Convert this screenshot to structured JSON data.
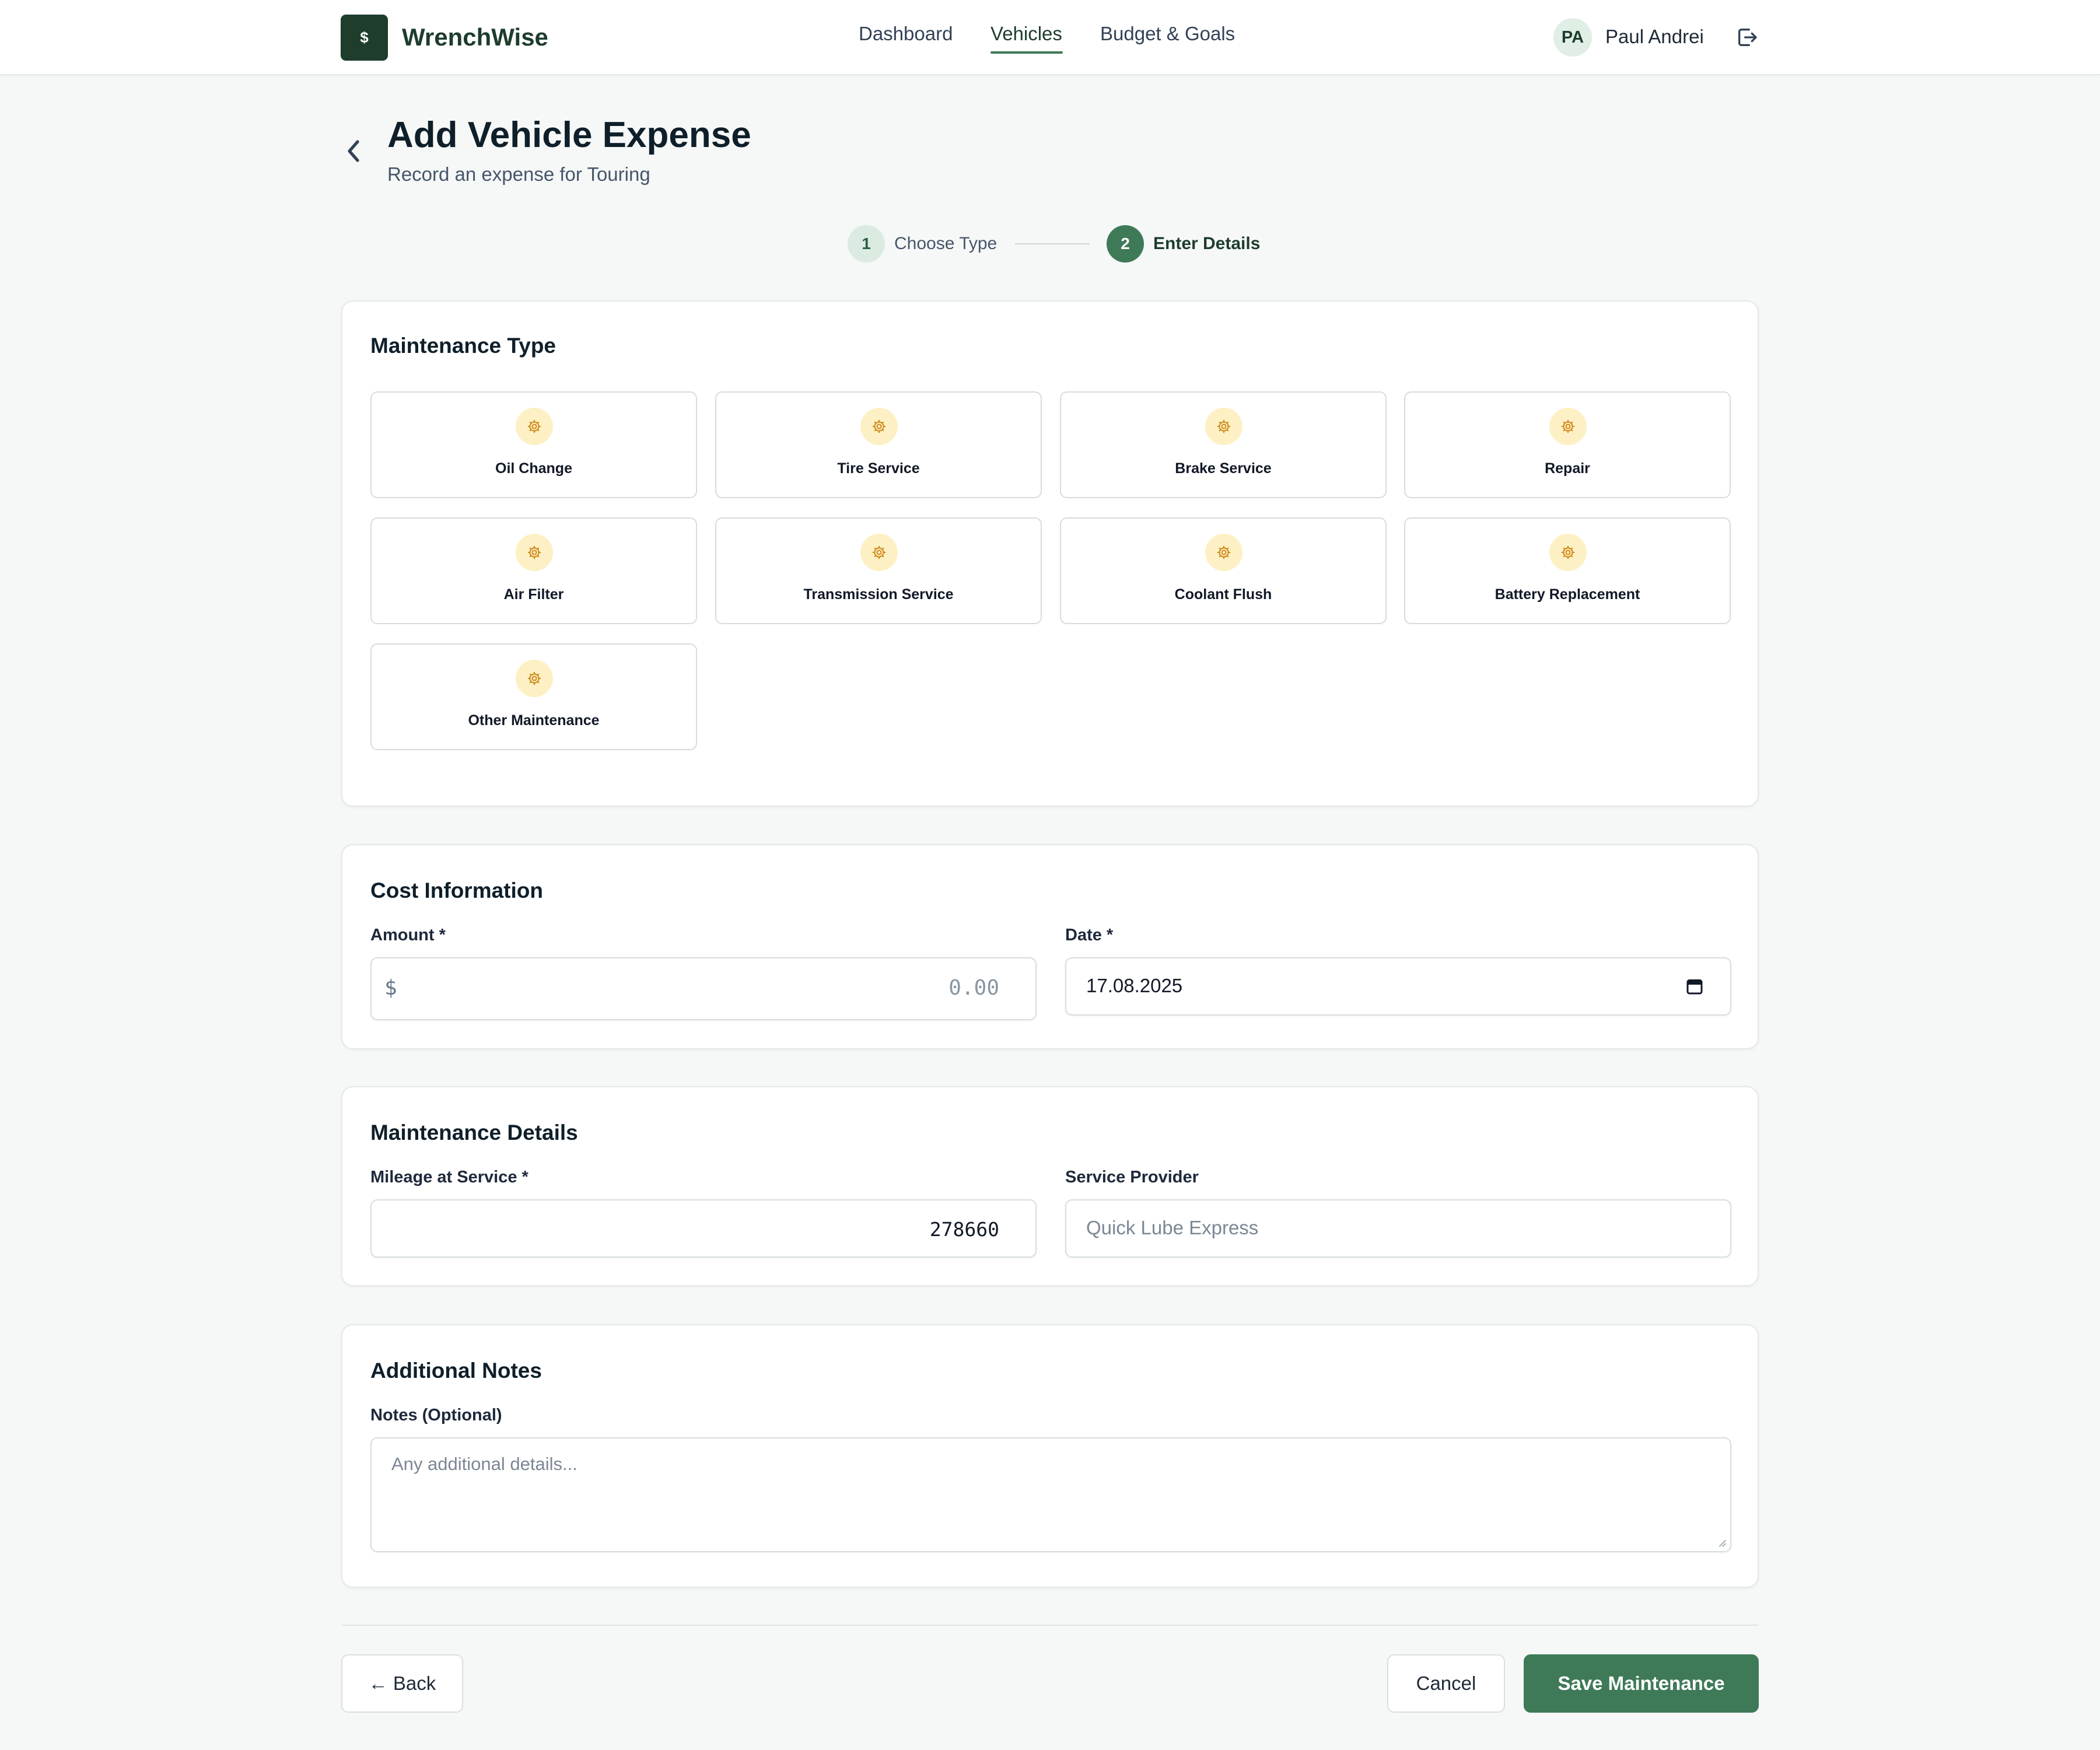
{
  "app": {
    "logo_symbol": "$",
    "name": "WrenchWise"
  },
  "nav": {
    "items": [
      {
        "label": "Dashboard",
        "active": false
      },
      {
        "label": "Vehicles",
        "active": true
      },
      {
        "label": "Budget & Goals",
        "active": false
      }
    ]
  },
  "user": {
    "initials": "PA",
    "name": "Paul Andrei"
  },
  "page": {
    "title": "Add Vehicle Expense",
    "subtitle": "Record an expense for Touring"
  },
  "stepper": {
    "steps": [
      {
        "number": "1",
        "label": "Choose Type"
      },
      {
        "number": "2",
        "label": "Enter Details"
      }
    ],
    "current_step": 2
  },
  "maintenance_type": {
    "title": "Maintenance Type",
    "icon": "gear-icon",
    "options": [
      {
        "label": "Oil Change"
      },
      {
        "label": "Tire Service"
      },
      {
        "label": "Brake Service"
      },
      {
        "label": "Repair"
      },
      {
        "label": "Air Filter"
      },
      {
        "label": "Transmission Service"
      },
      {
        "label": "Coolant Flush"
      },
      {
        "label": "Battery Replacement"
      },
      {
        "label": "Other Maintenance"
      }
    ]
  },
  "cost": {
    "title": "Cost Information",
    "amount_label": "Amount *",
    "currency_symbol": "$",
    "amount_placeholder": "0.00",
    "amount_value": "",
    "date_label": "Date *",
    "date_value": "17.08.2025"
  },
  "details": {
    "title": "Maintenance Details",
    "mileage_label": "Mileage at Service *",
    "mileage_value": "278660",
    "provider_label": "Service Provider",
    "provider_placeholder": "Quick Lube Express",
    "provider_value": ""
  },
  "notes": {
    "title": "Additional Notes",
    "label": "Notes (Optional)",
    "placeholder": "Any additional details..."
  },
  "actions": {
    "back": "← Back",
    "cancel": "Cancel",
    "save": "Save Maintenance"
  },
  "colors": {
    "brand_dark": "#1e3d2c",
    "primary": "#3f7a58",
    "icon_bg": "#fdf0c4",
    "icon_fg": "#d08a1b"
  }
}
